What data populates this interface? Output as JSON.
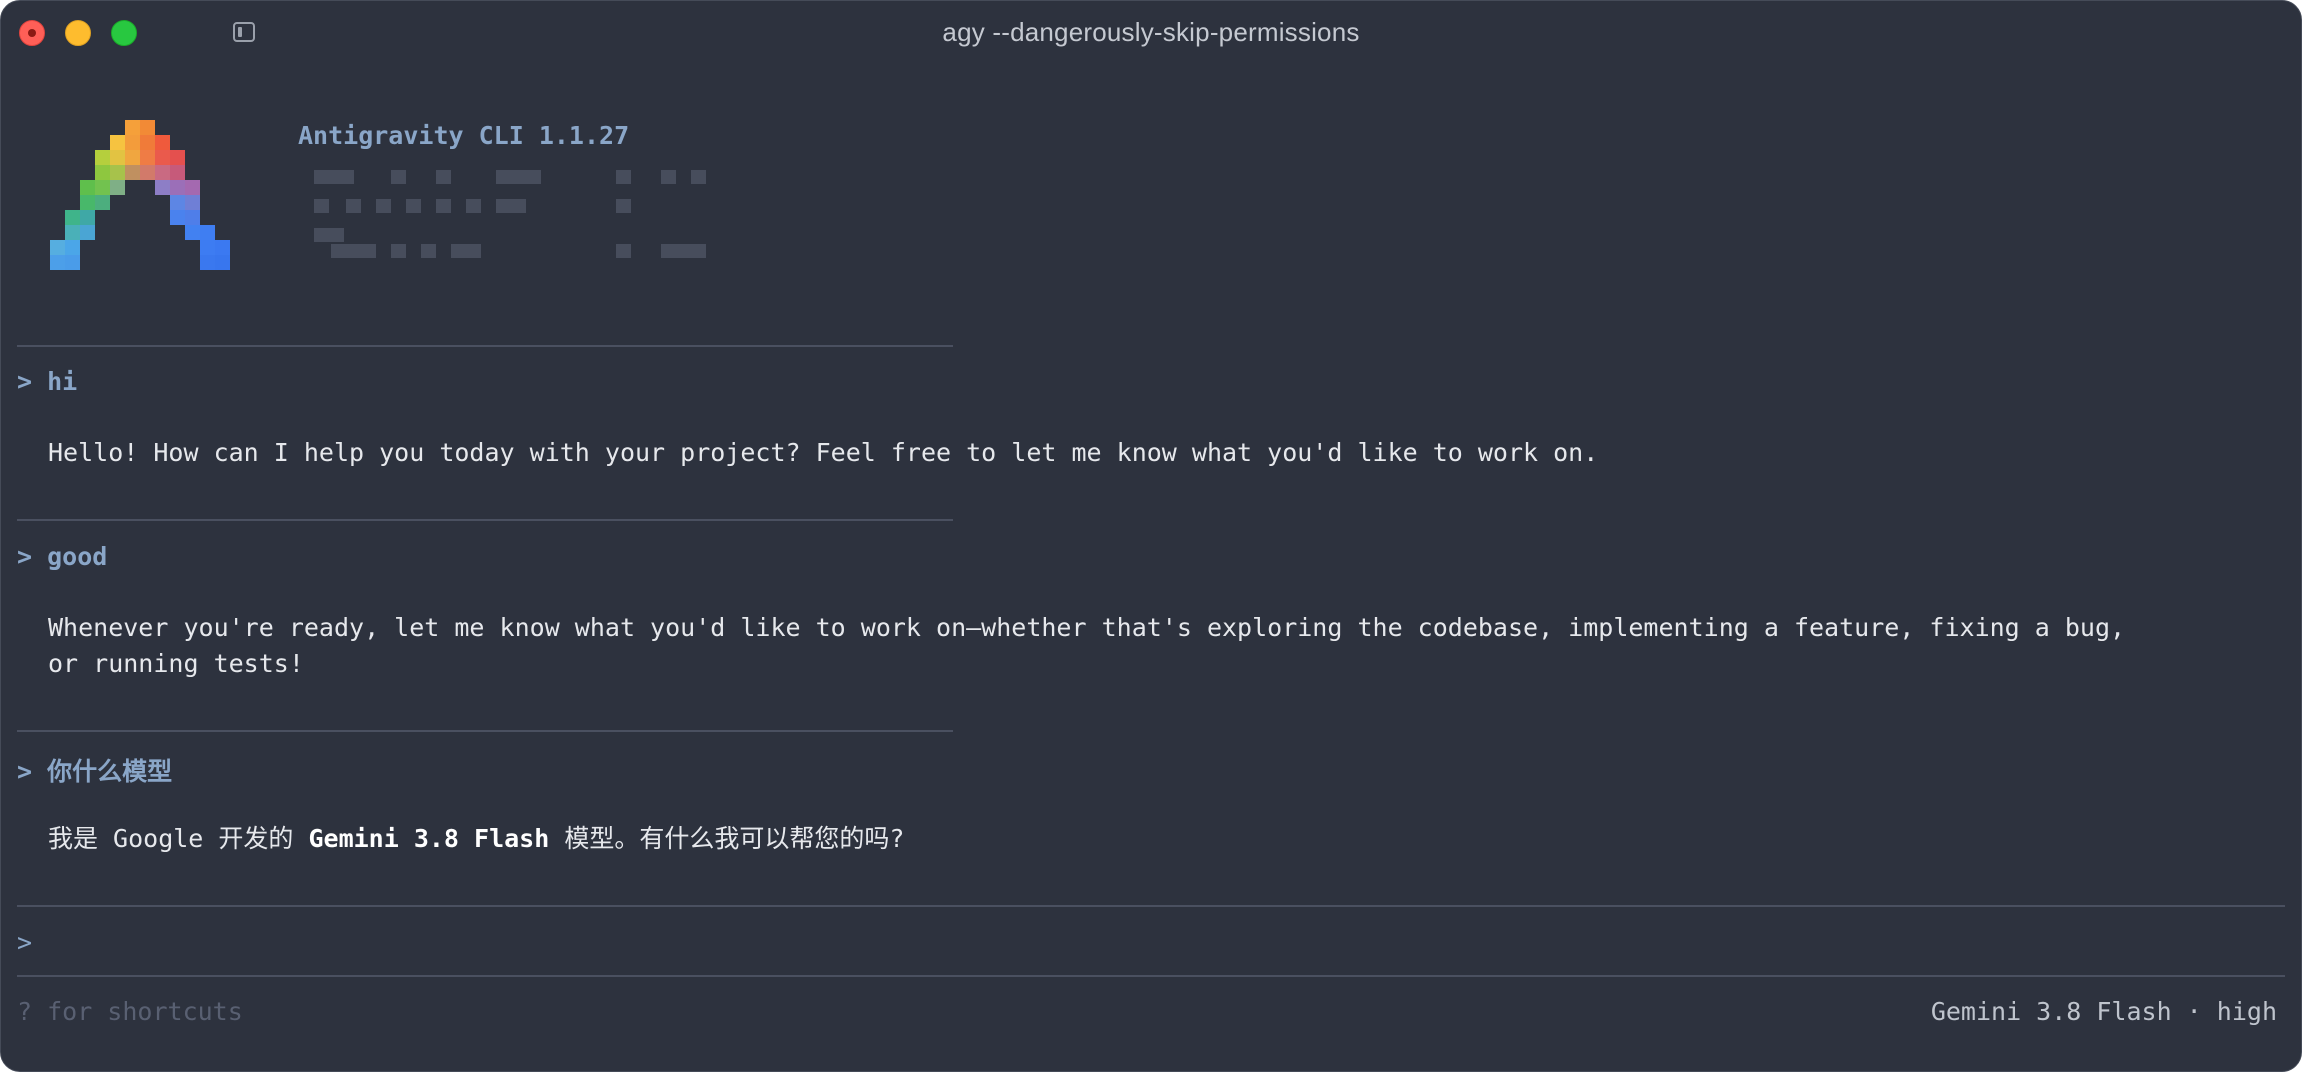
{
  "window": {
    "title": "agy --dangerously-skip-permissions"
  },
  "header": {
    "app_name": "Antigravity CLI 1.1.27"
  },
  "conversation": [
    {
      "prompt": "hi",
      "response_lines": [
        "Hello! How can I help you today with your project? Feel free to let me know what you'd like to work on."
      ]
    },
    {
      "prompt": "good",
      "response_lines": [
        "Whenever you're ready, let me know what you'd like to work on—whether that's exploring the codebase, implementing a feature, fixing a bug,",
        "or running tests!"
      ]
    },
    {
      "prompt": "你什么模型",
      "response": {
        "before": "我是 Google 开发的 ",
        "bold": "Gemini 3.8 Flash",
        "after": " 模型。有什么我可以帮您的吗?"
      }
    }
  ],
  "prompt_symbol": ">",
  "input": {
    "caret": ">",
    "value": ""
  },
  "footer": {
    "hint": "? for shortcuts",
    "model_status": "Gemini 3.8 Flash · high"
  },
  "colors": {
    "background": "#2d323e",
    "accent": "#8aa6c8",
    "text": "#e6e8ec",
    "muted": "#596072",
    "divider": "#4a5060"
  },
  "icons": {
    "close": "close-traffic-light",
    "minimize": "minimize-traffic-light",
    "maximize": "maximize-traffic-light",
    "sidebar": "sidebar-toggle-icon",
    "logo": "antigravity-pixel-logo"
  }
}
